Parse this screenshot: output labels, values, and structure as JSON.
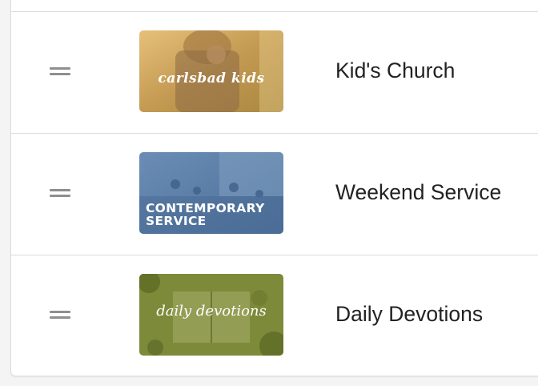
{
  "list": {
    "items": [
      {
        "title": "Kid's Church",
        "thumbnail_text": "carlsbad kids",
        "thumbnail_tint": "#c9a35a"
      },
      {
        "title": "Weekend Service",
        "thumbnail_text_line1": "CONTEMPORARY",
        "thumbnail_text_line2": "SERVICE",
        "thumbnail_tint": "#5b7fa8"
      },
      {
        "title": "Daily Devotions",
        "thumbnail_text": "daily devotions",
        "thumbnail_tint": "#7f8b3a"
      }
    ]
  },
  "icons": {
    "drag_handle": "drag-handle-icon"
  },
  "colors": {
    "border": "#dcdcdc",
    "handle": "#8e8e8e",
    "text": "#222222"
  }
}
